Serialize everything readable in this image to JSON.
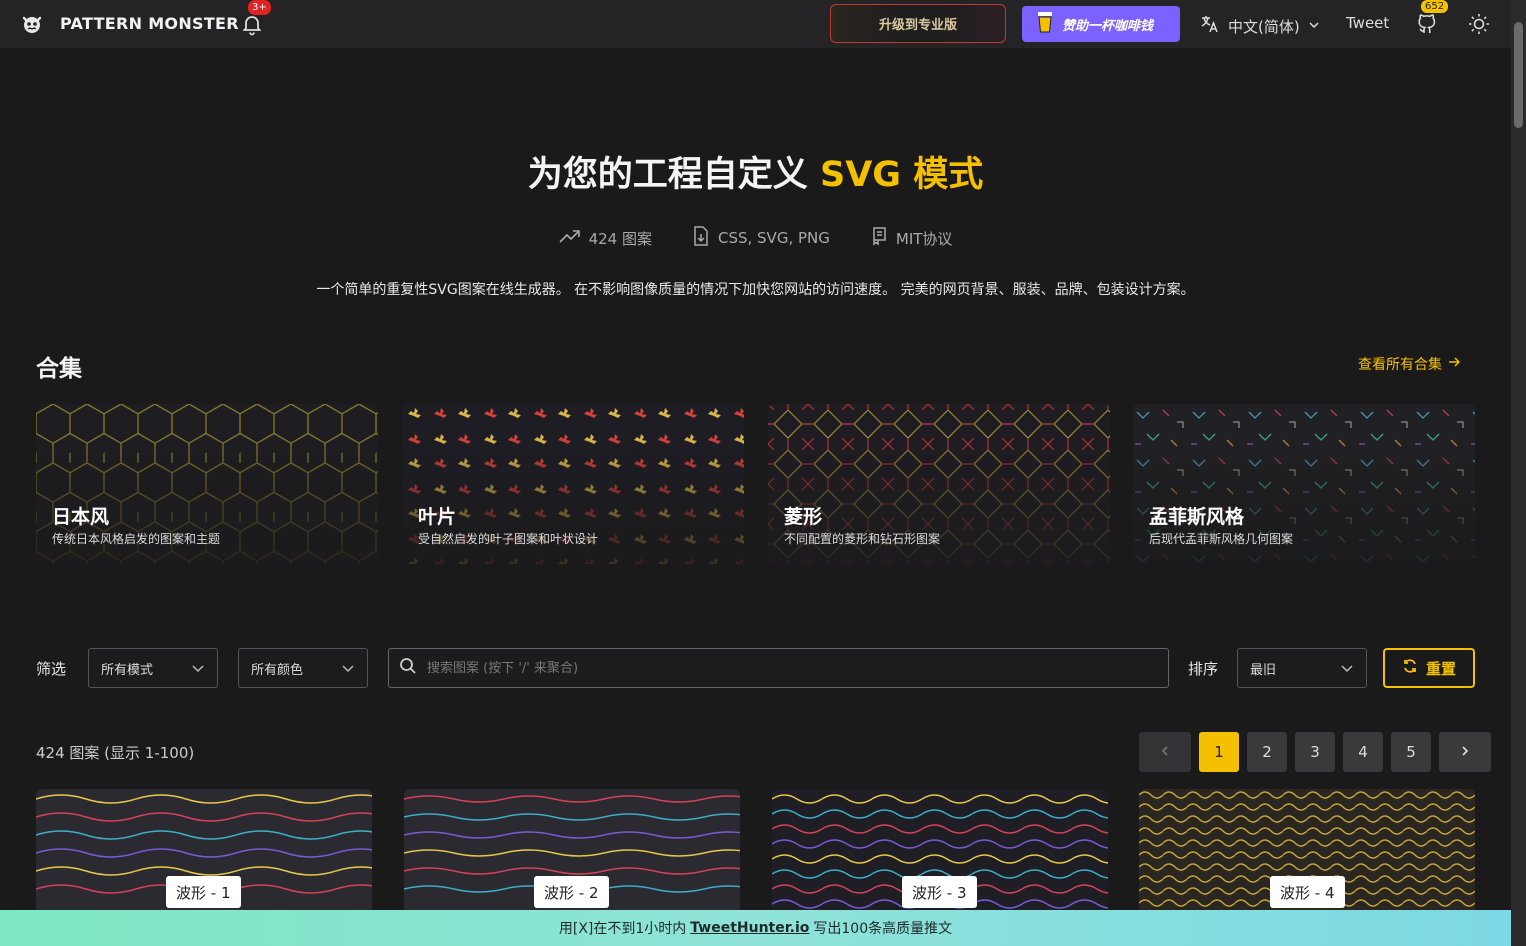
{
  "nav": {
    "brand": "PATTERN MONSTER",
    "bell_badge": "3+",
    "pro_label": "升级到专业版",
    "coffee_label": "赞助一杯咖啡钱",
    "language": "中文(简体)",
    "tweet": "Tweet",
    "github_stars": "652"
  },
  "hero": {
    "title_main": "为您的工程自定义 ",
    "title_accent": "SVG 模式",
    "stats": {
      "patterns": "424 图案",
      "formats": "CSS, SVG, PNG",
      "license": "MIT协议"
    },
    "description": "一个简单的重复性SVG图案在线生成器。 在不影响图像质量的情况下加快您网站的访问速度。 完美的网页背景、服装、品牌、包装设计方案。"
  },
  "collections": {
    "heading": "合集",
    "see_all": "查看所有合集",
    "items": [
      {
        "title": "日本风",
        "subtitle": "传统日本风格启发的图案和主题"
      },
      {
        "title": "叶片",
        "subtitle": "受自然启发的叶子图案和叶状设计"
      },
      {
        "title": "菱形",
        "subtitle": "不同配置的菱形和钻石形图案"
      },
      {
        "title": "孟菲斯风格",
        "subtitle": "后现代孟菲斯风格几何图案"
      }
    ]
  },
  "filters": {
    "label": "筛选",
    "mode": "所有模式",
    "color": "所有颜色",
    "search_placeholder": "搜索图案 (按下 '/' 来聚合)",
    "sort_label": "排序",
    "sort_value": "最旧",
    "reset": "重置"
  },
  "results": {
    "count": "424 图案 (显示 1-100)",
    "pages": [
      "1",
      "2",
      "3",
      "4",
      "5"
    ],
    "active_page": "1",
    "cards": [
      {
        "label": "波形 - 1"
      },
      {
        "label": "波形 - 2"
      },
      {
        "label": "波形 - 3"
      },
      {
        "label": "波形 - 4"
      }
    ]
  },
  "banner": {
    "prefix": "用[X]在不到1小时内",
    "link": "TweetHunter.io",
    "suffix": "写出100条高质量推文"
  },
  "colors": {
    "accent": "#f5c000",
    "background": "#1a1a1b",
    "nav": "#242426",
    "coffee": "#7b61ff"
  }
}
